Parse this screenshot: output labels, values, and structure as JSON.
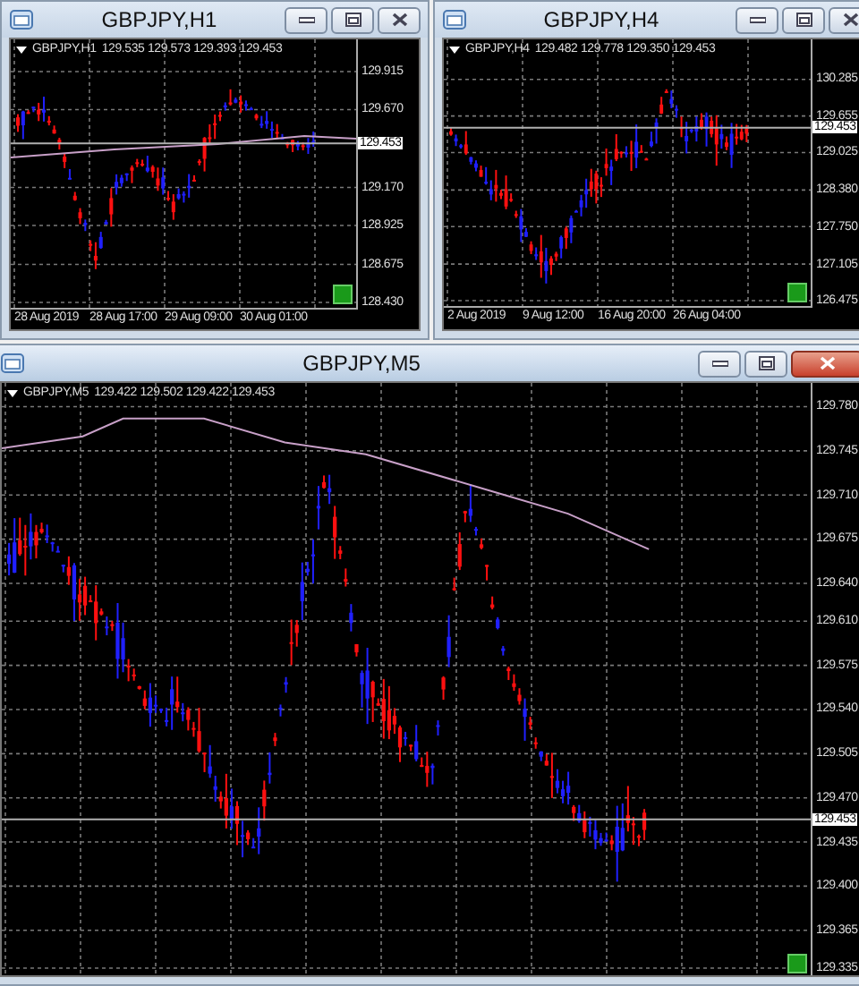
{
  "windows": [
    {
      "title": "GBPJPY,H1",
      "active": false,
      "symbol": "GBPJPY,H1",
      "quote": "129.535 129.573 129.393 129.453",
      "price_ticks": [
        "129.915",
        "129.670",
        "129.170",
        "128.925",
        "128.675",
        "128.430"
      ],
      "current_price": "129.453",
      "time_labels": [
        "28 Aug 2019",
        "28 Aug 17:00",
        "29 Aug 09:00",
        "30 Aug 01:00"
      ]
    },
    {
      "title": "GBPJPY,H4",
      "active": false,
      "symbol": "GBPJPY,H4",
      "quote": "129.482 129.778 129.350 129.453",
      "price_ticks": [
        "130.285",
        "129.655",
        "129.025",
        "128.380",
        "127.750",
        "127.105",
        "126.475"
      ],
      "current_price": "129.453",
      "time_labels": [
        "2 Aug 2019",
        "9 Aug 12:00",
        "16 Aug 20:00",
        "26 Aug 04:00"
      ]
    },
    {
      "title": "GBPJPY,M5",
      "active": true,
      "symbol": "GBPJPY,M5",
      "quote": "129.422 129.502 129.422 129.453",
      "price_ticks": [
        "129.780",
        "129.745",
        "129.710",
        "129.675",
        "129.640",
        "129.610",
        "129.575",
        "129.540",
        "129.505",
        "129.470",
        "129.435",
        "129.400",
        "129.365",
        "129.335"
      ],
      "current_price": "129.453"
    }
  ]
}
